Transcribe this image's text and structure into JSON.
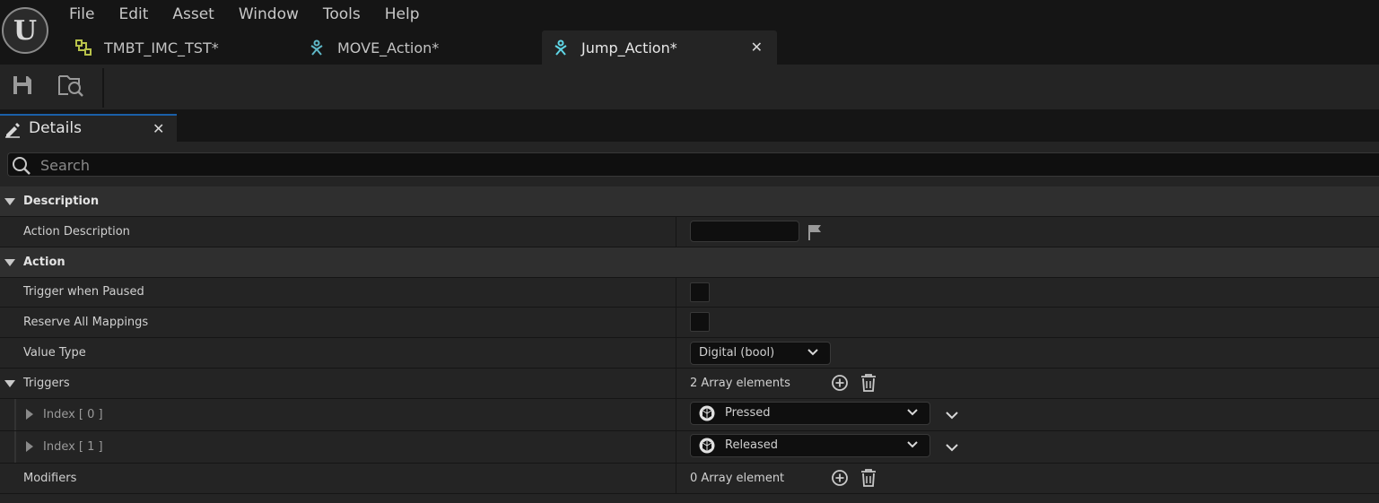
{
  "menu": [
    "File",
    "Edit",
    "Asset",
    "Window",
    "Tools",
    "Help"
  ],
  "tabs": [
    {
      "label": "TMBT_IMC_TST*",
      "icon": "input-mapping-context-icon"
    },
    {
      "label": "MOVE_Action*",
      "icon": "input-action-icon"
    },
    {
      "label": "Jump_Action*",
      "icon": "input-action-icon",
      "active": true
    }
  ],
  "toolbar": {
    "save_icon": "save-icon",
    "browse_icon": "browse-asset-icon"
  },
  "details_tab": {
    "label": "Details"
  },
  "search": {
    "placeholder": "Search"
  },
  "rows": {
    "description": "Description",
    "action_description": "Action Description",
    "action": "Action",
    "trigger_when_paused": "Trigger when Paused",
    "reserve_all_mappings": "Reserve All Mappings",
    "value_type": "Value Type",
    "value_type_value": "Digital (bool)",
    "triggers": "Triggers",
    "triggers_count": "2 Array elements",
    "index0": "Index [ 0 ]",
    "index0_value": "Pressed",
    "index1": "Index [ 1 ]",
    "index1_value": "Released",
    "modifiers": "Modifiers",
    "modifiers_count": "0 Array element"
  },
  "colors": {
    "accent": "#1a5fa8",
    "background": "#242424",
    "category": "#2f2f2f"
  }
}
